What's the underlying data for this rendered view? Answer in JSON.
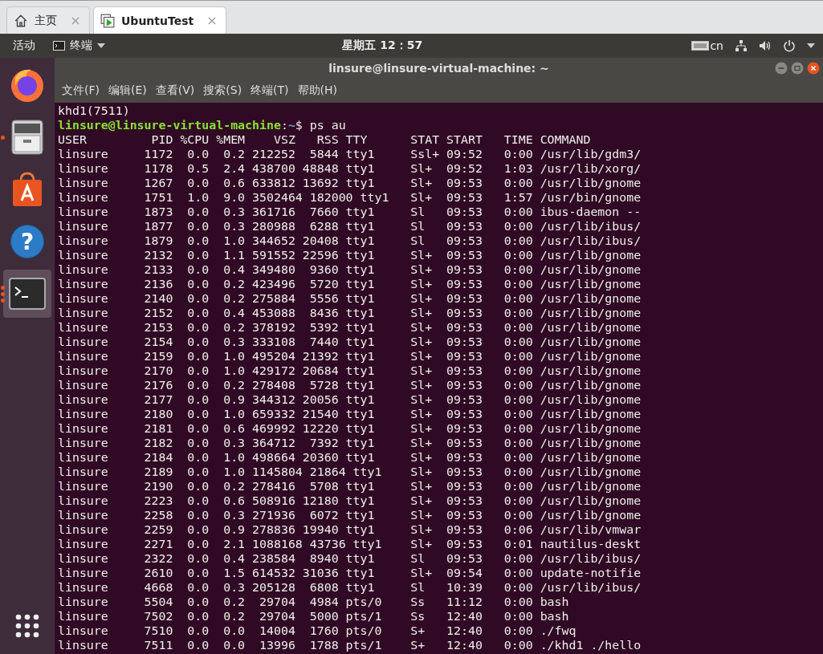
{
  "vm_tabs": [
    {
      "label": "主页",
      "kind": "home",
      "selected": false
    },
    {
      "label": "UbuntuTest",
      "kind": "vm",
      "selected": true
    }
  ],
  "top_bar": {
    "activities": "活动",
    "app_menu": "终端",
    "clock": "星期五 12：57",
    "input_method": "cn"
  },
  "dock": {
    "items": [
      {
        "kind": "firefox",
        "running": false,
        "selected": false
      },
      {
        "kind": "files",
        "running": true,
        "multiple_windows": false,
        "selected": false
      },
      {
        "kind": "software",
        "running": false,
        "selected": false
      },
      {
        "kind": "help",
        "glyph": "?",
        "running": false,
        "selected": false
      },
      {
        "kind": "terminal",
        "running": true,
        "multiple_windows": true,
        "selected": true
      },
      {
        "kind": "apps",
        "running": false,
        "selected": false
      }
    ]
  },
  "window": {
    "title": "linsure@linsure-virtual-machine: ~",
    "menu": [
      "文件(F)",
      "编辑(E)",
      "查看(V)",
      "搜索(S)",
      "终端(T)",
      "帮助(H)"
    ]
  },
  "terminal": {
    "lines": [
      {
        "kind": "output",
        "text": "khd1(7511)"
      },
      {
        "kind": "prompt",
        "user_host": "linsure@linsure-virtual-machine",
        "separator": ":",
        "path": "~",
        "symbol": "$",
        "command": "ps au"
      },
      {
        "kind": "output",
        "text": "USER         PID %CPU %MEM    VSZ   RSS TTY      STAT START   TIME COMMAND"
      },
      {
        "kind": "output",
        "text": "linsure     1172  0.0  0.2 212252  5844 tty1     Ssl+ 09:52   0:00 /usr/lib/gdm3/"
      },
      {
        "kind": "output",
        "text": "linsure     1178  0.5  2.4 438700 48848 tty1     Sl+  09:52   1:03 /usr/lib/xorg/"
      },
      {
        "kind": "output",
        "text": "linsure     1267  0.0  0.6 633812 13692 tty1     Sl+  09:53   0:00 /usr/lib/gnome"
      },
      {
        "kind": "output",
        "text": "linsure     1751  1.0  9.0 3502464 182000 tty1   Sl+  09:53   1:57 /usr/bin/gnome"
      },
      {
        "kind": "output",
        "text": "linsure     1873  0.0  0.3 361716  7660 tty1     Sl   09:53   0:00 ibus-daemon --"
      },
      {
        "kind": "output",
        "text": "linsure     1877  0.0  0.3 280988  6288 tty1     Sl   09:53   0:00 /usr/lib/ibus/"
      },
      {
        "kind": "output",
        "text": "linsure     1879  0.0  1.0 344652 20408 tty1     Sl   09:53   0:00 /usr/lib/ibus/"
      },
      {
        "kind": "output",
        "text": "linsure     2132  0.0  1.1 591552 22596 tty1     Sl+  09:53   0:00 /usr/lib/gnome"
      },
      {
        "kind": "output",
        "text": "linsure     2133  0.0  0.4 349480  9360 tty1     Sl+  09:53   0:00 /usr/lib/gnome"
      },
      {
        "kind": "output",
        "text": "linsure     2136  0.0  0.2 423496  5720 tty1     Sl+  09:53   0:00 /usr/lib/gnome"
      },
      {
        "kind": "output",
        "text": "linsure     2140  0.0  0.2 275884  5556 tty1     Sl+  09:53   0:00 /usr/lib/gnome"
      },
      {
        "kind": "output",
        "text": "linsure     2152  0.0  0.4 453088  8436 tty1     Sl+  09:53   0:00 /usr/lib/gnome"
      },
      {
        "kind": "output",
        "text": "linsure     2153  0.0  0.2 378192  5392 tty1     Sl+  09:53   0:00 /usr/lib/gnome"
      },
      {
        "kind": "output",
        "text": "linsure     2154  0.0  0.3 333108  7440 tty1     Sl+  09:53   0:00 /usr/lib/gnome"
      },
      {
        "kind": "output",
        "text": "linsure     2159  0.0  1.0 495204 21392 tty1     Sl+  09:53   0:00 /usr/lib/gnome"
      },
      {
        "kind": "output",
        "text": "linsure     2170  0.0  1.0 429172 20684 tty1     Sl+  09:53   0:00 /usr/lib/gnome"
      },
      {
        "kind": "output",
        "text": "linsure     2176  0.0  0.2 278408  5728 tty1     Sl+  09:53   0:00 /usr/lib/gnome"
      },
      {
        "kind": "output",
        "text": "linsure     2177  0.0  0.9 344312 20056 tty1     Sl+  09:53   0:00 /usr/lib/gnome"
      },
      {
        "kind": "output",
        "text": "linsure     2180  0.0  1.0 659332 21540 tty1     Sl+  09:53   0:00 /usr/lib/gnome"
      },
      {
        "kind": "output",
        "text": "linsure     2181  0.0  0.6 469992 12220 tty1     Sl+  09:53   0:00 /usr/lib/gnome"
      },
      {
        "kind": "output",
        "text": "linsure     2182  0.0  0.3 364712  7392 tty1     Sl+  09:53   0:00 /usr/lib/gnome"
      },
      {
        "kind": "output",
        "text": "linsure     2184  0.0  1.0 498664 20360 tty1     Sl+  09:53   0:00 /usr/lib/gnome"
      },
      {
        "kind": "output",
        "text": "linsure     2189  0.0  1.0 1145804 21864 tty1    Sl+  09:53   0:00 /usr/lib/gnome"
      },
      {
        "kind": "output",
        "text": "linsure     2190  0.0  0.2 278416  5708 tty1     Sl+  09:53   0:00 /usr/lib/gnome"
      },
      {
        "kind": "output",
        "text": "linsure     2223  0.0  0.6 508916 12180 tty1     Sl+  09:53   0:00 /usr/lib/gnome"
      },
      {
        "kind": "output",
        "text": "linsure     2258  0.0  0.3 271936  6072 tty1     Sl+  09:53   0:00 /usr/lib/gnome"
      },
      {
        "kind": "output",
        "text": "linsure     2259  0.0  0.9 278836 19940 tty1     Sl+  09:53   0:06 /usr/lib/vmwar"
      },
      {
        "kind": "output",
        "text": "linsure     2271  0.0  2.1 1088168 43736 tty1    Sl+  09:53   0:01 nautilus-deskt"
      },
      {
        "kind": "output",
        "text": "linsure     2322  0.0  0.4 238584  8940 tty1     Sl   09:53   0:00 /usr/lib/ibus/"
      },
      {
        "kind": "output",
        "text": "linsure     2610  0.0  1.5 614532 31036 tty1     Sl+  09:54   0:00 update-notifie"
      },
      {
        "kind": "output",
        "text": "linsure     4668  0.0  0.3 205128  6808 tty1     Sl   10:39   0:00 /usr/lib/ibus/"
      },
      {
        "kind": "output",
        "text": "linsure     5504  0.0  0.2  29704  4984 pts/0    Ss   11:12   0:00 bash"
      },
      {
        "kind": "output",
        "text": "linsure     7502  0.0  0.2  29704  5000 pts/1    Ss   12:40   0:00 bash"
      },
      {
        "kind": "output",
        "text": "linsure     7510  0.0  0.0  14004  1760 pts/0    S+   12:40   0:00 ./fwq"
      },
      {
        "kind": "output",
        "text": "linsure     7511  0.0  0.0  13996  1788 pts/1    S+   12:40   0:00 ./khd1 ./hello"
      }
    ]
  }
}
